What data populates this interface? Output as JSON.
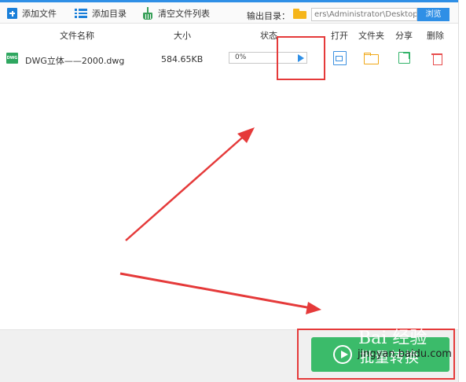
{
  "toolbar": {
    "add_file_label": "添加文件",
    "add_folder_label": "添加目录",
    "clear_list_label": "清空文件列表",
    "output_dir_label": "输出目录：",
    "output_path_value": "ers\\Administrator\\Desktop",
    "browse_label": "浏览"
  },
  "table": {
    "headers": {
      "name": "文件名称",
      "size": "大小",
      "status": "状态",
      "open": "打开",
      "folder": "文件夹",
      "share": "分享",
      "delete": "删除"
    },
    "rows": [
      {
        "icon_text": "DWG",
        "name": "DWG立体——2000.dwg",
        "size": "584.65KB",
        "progress_text": "0%",
        "progress": 0
      }
    ]
  },
  "convert_button": {
    "label": "批量转换"
  },
  "watermark": {
    "text": "Bai 经验",
    "url": "jingyan.baidu.com"
  },
  "colors": {
    "accent_blue": "#2f8fe6",
    "convert_green": "#3bbb6a",
    "annotation_red": "#e53a3a",
    "folder_yellow": "#f5b51a"
  }
}
